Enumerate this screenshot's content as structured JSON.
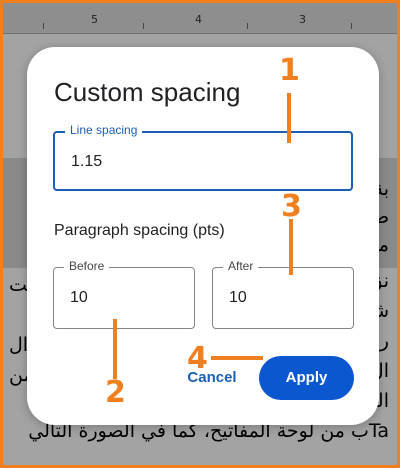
{
  "ruler": {
    "marks": [
      "5",
      "4",
      "3"
    ]
  },
  "background_text": {
    "lines": [
      "بة",
      "طان",
      "مر",
      "نق",
      "شر",
      "را",
      "ال ",
      "المست",
      "Taب من لوحة المفاتيح، كما في الصورة التالي"
    ],
    "left_fragments": [
      "لت",
      "ال",
      "من"
    ]
  },
  "dialog": {
    "title": "Custom spacing",
    "line_spacing": {
      "label": "Line spacing",
      "value": "1.15"
    },
    "paragraph_section": "Paragraph spacing (pts)",
    "before": {
      "label": "Before",
      "value": "10"
    },
    "after": {
      "label": "After",
      "value": "10"
    },
    "cancel_label": "Cancel",
    "apply_label": "Apply"
  },
  "annotations": [
    "1",
    "2",
    "3",
    "4"
  ],
  "colors": {
    "accent": "#f07f1f",
    "primary": "#0b57d0",
    "focus": "#1a5fb4"
  }
}
